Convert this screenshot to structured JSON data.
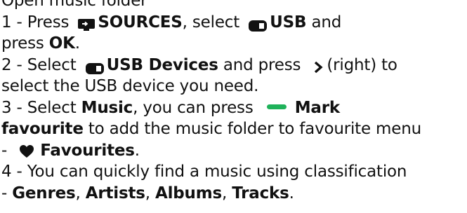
{
  "lines": [
    {
      "t1": "Open music folder"
    },
    {
      "t1": "1 - Press ",
      "icon": "sources-icon",
      "k1": "SOURCES",
      "t2": ", select ",
      "icon2": "usb-icon",
      "k2": "USB",
      "t3": " and"
    },
    {
      "t1": "press ",
      "k1": "OK",
      "t2": "."
    },
    {
      "t1": "2 - Select ",
      "icon": "usb-icon",
      "k1": "USB Devices",
      "t2": " and press ",
      "icon2": "chevron-right-icon",
      "t3": "(right) to"
    },
    {
      "t1": "select the USB device you need."
    },
    {
      "t1": "3 - Select ",
      "k1": "Music",
      "t2": ", you can press ",
      "icon": "green-key-icon",
      "k2": "Mark"
    },
    {
      "k1": "favourite",
      "t1": " to add the music folder to favourite menu"
    },
    {
      "t1": "- ",
      "icon": "heart-icon",
      "k1": "Favourites",
      "t2": "."
    },
    {
      "t1": "4 - You can quickly find a music using classification"
    },
    {
      "t1": "- ",
      "k1": "Genres",
      "t2": ", ",
      "k2": "Artists",
      "t3": ", ",
      "k3": "Albums",
      "t4": ", ",
      "k4": "Tracks",
      "t5": "."
    }
  ],
  "colors": {
    "green_key": "#1fb25a",
    "text": "#111111"
  }
}
